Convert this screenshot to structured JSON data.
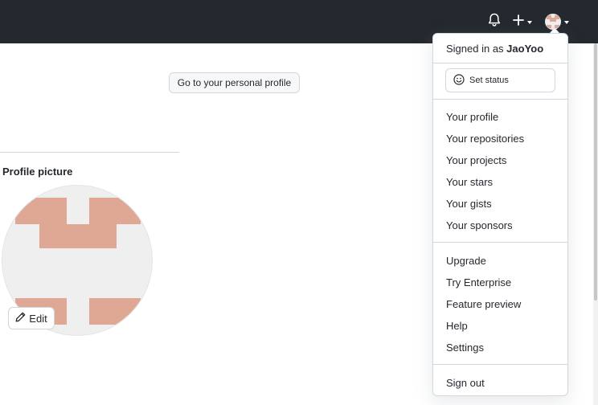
{
  "header": {
    "icons": [
      "bell-icon",
      "plus-icon",
      "avatar"
    ],
    "background": "#24292f"
  },
  "main": {
    "profile_link_label": "Go to your personal profile",
    "profile_picture_label": "Profile picture",
    "edit_label": "Edit"
  },
  "dropdown": {
    "signed_in_prefix": "Signed in as ",
    "username": "JaoYoo",
    "set_status_label": "Set status",
    "profile_items": [
      "Your profile",
      "Your repositories",
      "Your projects",
      "Your stars",
      "Your gists",
      "Your sponsors"
    ],
    "help_items": [
      "Upgrade",
      "Try Enterprise",
      "Feature preview",
      "Help",
      "Settings"
    ],
    "sign_out_label": "Sign out"
  },
  "colors": {
    "avatar_accent": "#dfa894",
    "avatar_bg": "#efefef",
    "border": "#d0d7de"
  }
}
